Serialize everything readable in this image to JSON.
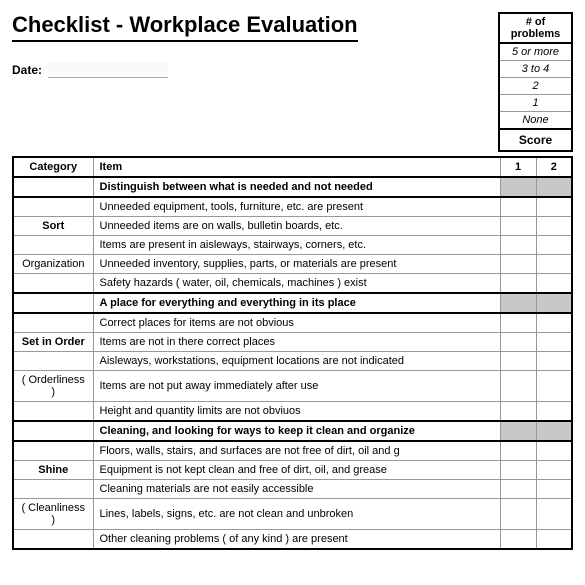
{
  "title": "Checklist - Workplace Evaluation",
  "date_label": "Date:",
  "problems": {
    "header": "# of problems",
    "levels": [
      "5 or more",
      "3 to 4",
      "2",
      "1",
      "None"
    ],
    "score_label": "Score"
  },
  "columns": {
    "category": "Category",
    "item": "Item",
    "score1": "1",
    "score2": "2"
  },
  "sections": [
    {
      "header": "Distinguish between what is needed and not needed",
      "cat_main": "Sort",
      "cat_sub": "Organization",
      "items": [
        "Unneeded equipment, tools, furniture, etc. are present",
        "Unneeded items are on walls, bulletin boards, etc.",
        "Items are present in aisleways, stairways, corners, etc.",
        "Unneeded inventory, supplies, parts, or materials are present",
        "Safety hazards ( water, oil, chemicals, machines ) exist"
      ]
    },
    {
      "header": "A place for everything and everything in its place",
      "cat_main": "Set in Order",
      "cat_sub": "( Orderliness )",
      "items": [
        "Correct places for items are not obvious",
        "Items are not in there correct places",
        "Aisleways, workstations, equipment locations are not indicated",
        "Items are not put away immediately after use",
        "Height and quantity limits are not obviuos"
      ]
    },
    {
      "header": "Cleaning, and looking for ways to keep it clean and organize",
      "cat_main": "Shine",
      "cat_sub": "( Cleanliness )",
      "items": [
        "Floors, walls, stairs, and surfaces are not free of dirt, oil and g",
        "Equipment is not kept clean and free of dirt, oil, and grease",
        "Cleaning materials are not easily accessible",
        "Lines, labels, signs, etc. are not clean and unbroken",
        "Other cleaning problems ( of any kind ) are present"
      ]
    }
  ]
}
